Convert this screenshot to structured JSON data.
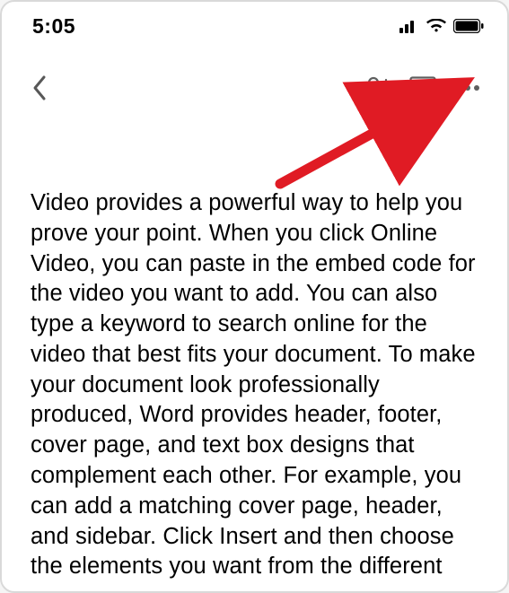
{
  "status": {
    "time": "5:05",
    "signal_bars": 3,
    "wifi": true,
    "battery_pct": 95
  },
  "toolbar": {
    "back_label": "Back",
    "add_person_label": "Add person",
    "comments_label": "Comments",
    "more_label": "More options"
  },
  "document": {
    "body": "Video provides a powerful way to help you prove your point. When you click Online Video, you can paste in the embed code for the video you want to add. You can also type a keyword to search online for the video that best fits your document. To make your document look professionally produced, Word provides header, footer, cover page, and text box designs that complement each other. For example, you can add a matching cover page, header, and sidebar. Click Insert and then choose the elements you want from the different"
  },
  "annotation": {
    "arrow_color": "#e01b24",
    "arrow_target": "more-options-button"
  }
}
